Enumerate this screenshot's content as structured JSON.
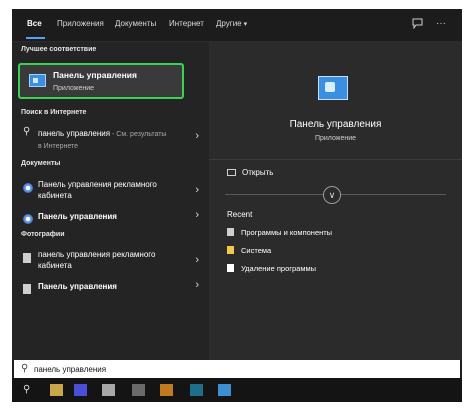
{
  "nav": {
    "tabs": [
      "Все",
      "Приложения",
      "Документы",
      "Интернет",
      "Другие"
    ],
    "active_index": 0,
    "more_caret": "▾",
    "right_icons": [
      "feedback-icon",
      "more-icon"
    ]
  },
  "best_match": {
    "header": "Лучшее соответствие",
    "name": "Панель управления",
    "type": "Приложение",
    "highlight_color": "#39d353"
  },
  "web": {
    "header": "Поиск в Интернете",
    "query": "панель управления",
    "suffix": " - См. результаты",
    "suffix2": "в Интернете"
  },
  "documents": {
    "header": "Документы",
    "items": [
      {
        "line1": "Панель управления рекламного",
        "line2": "кабинета"
      },
      {
        "line1": "Панель управления",
        "line2": ""
      }
    ]
  },
  "photos": {
    "header": "Фотографии",
    "items": [
      {
        "line1": "панель управления рекламного",
        "line2": "кабинета"
      },
      {
        "line1": "Панель управления",
        "line2": ""
      }
    ]
  },
  "preview": {
    "title": "Панель управления",
    "type": "Приложение",
    "open_label": "Открыть",
    "recent_header": "Recent",
    "recent": [
      "Программы и компоненты",
      "Система",
      "Удаление программы"
    ]
  },
  "search": {
    "value": "панель управления"
  },
  "accent": "#4da3ff"
}
